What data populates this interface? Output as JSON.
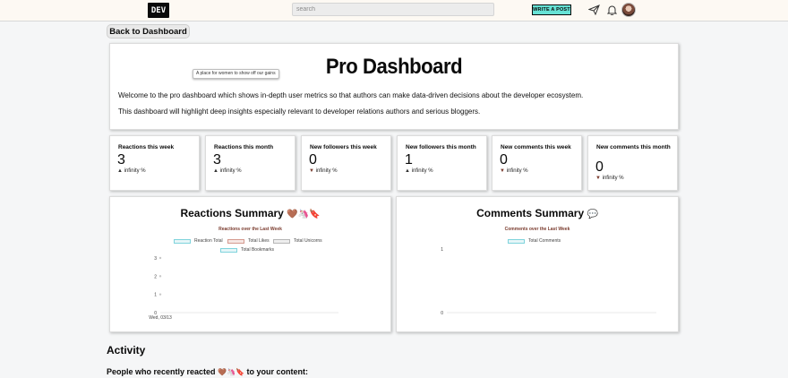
{
  "header": {
    "logo": "DEV",
    "search_placeholder": "search",
    "write_post": "WRITE A POST",
    "icons": [
      "paper-plane-icon",
      "bell-icon",
      "avatar"
    ]
  },
  "back_button": "Back to Dashboard",
  "hero": {
    "tooltip": "A place for women to show off our gains",
    "title": "Pro Dashboard",
    "p1": "Welcome to the pro dashboard which shows in-depth user metrics so that authors can make data-driven decisions about the developer ecosystem.",
    "p2": "This dashboard will highlight deep insights especially relevant to developer relations authors and serious bloggers."
  },
  "stats": [
    {
      "label": "Reactions this week",
      "value": "3",
      "arrow": "▲",
      "change": "infinity %",
      "direction": "up"
    },
    {
      "label": "Reactions this month",
      "value": "3",
      "arrow": "▲",
      "change": "infinity %",
      "direction": "up"
    },
    {
      "label": "New followers this week",
      "value": "0",
      "arrow": "▼",
      "change": "infinity %",
      "direction": "down"
    },
    {
      "label": "New followers this month",
      "value": "1",
      "arrow": "▲",
      "change": "infinity %",
      "direction": "up"
    },
    {
      "label": "New comments this week",
      "value": "0",
      "arrow": "▼",
      "change": "infinity %",
      "direction": "down"
    },
    {
      "label": "New comments this month",
      "value": "0",
      "arrow": "▼",
      "change": "infinity %",
      "direction": "down"
    }
  ],
  "reactions_chart": {
    "heading": "Reactions Summary",
    "heading_emoji": "🤎🦄🔖",
    "legend_colors": {
      "reaction_total": "#7fd3dc",
      "total_likes": "#d49a8f",
      "total_unicorns": "#b5b5b5",
      "total_bookmarks": "#7fd3dc"
    }
  },
  "comments_chart": {
    "heading": "Comments Summary",
    "heading_emoji": "💬",
    "legend_colors": {
      "total_comments": "#7fd3dc"
    }
  },
  "activity": {
    "heading": "Activity",
    "sub_prefix": "People who recently reacted",
    "sub_emoji": "🤎🦄🔖",
    "sub_suffix": "to your content:"
  },
  "chart_data": [
    {
      "type": "line",
      "title": "Reactions over the Last Week",
      "x": [
        "Wed, 03/13"
      ],
      "series": [
        {
          "name": "Reaction Total",
          "values": [
            null
          ]
        },
        {
          "name": "Total Likes",
          "values": [
            null
          ]
        },
        {
          "name": "Total Unicorns",
          "values": [
            null
          ]
        },
        {
          "name": "Total Bookmarks",
          "values": [
            null
          ]
        }
      ],
      "yticks": [
        "0",
        "1",
        "2",
        "3"
      ],
      "ylim": [
        0,
        3
      ],
      "legend": "top"
    },
    {
      "type": "line",
      "title": "Comments over the Last Week",
      "x": [],
      "series": [
        {
          "name": "Total Comments",
          "values": []
        }
      ],
      "yticks": [
        "0",
        "1"
      ],
      "ylim": [
        0,
        1
      ],
      "legend": "top"
    }
  ]
}
